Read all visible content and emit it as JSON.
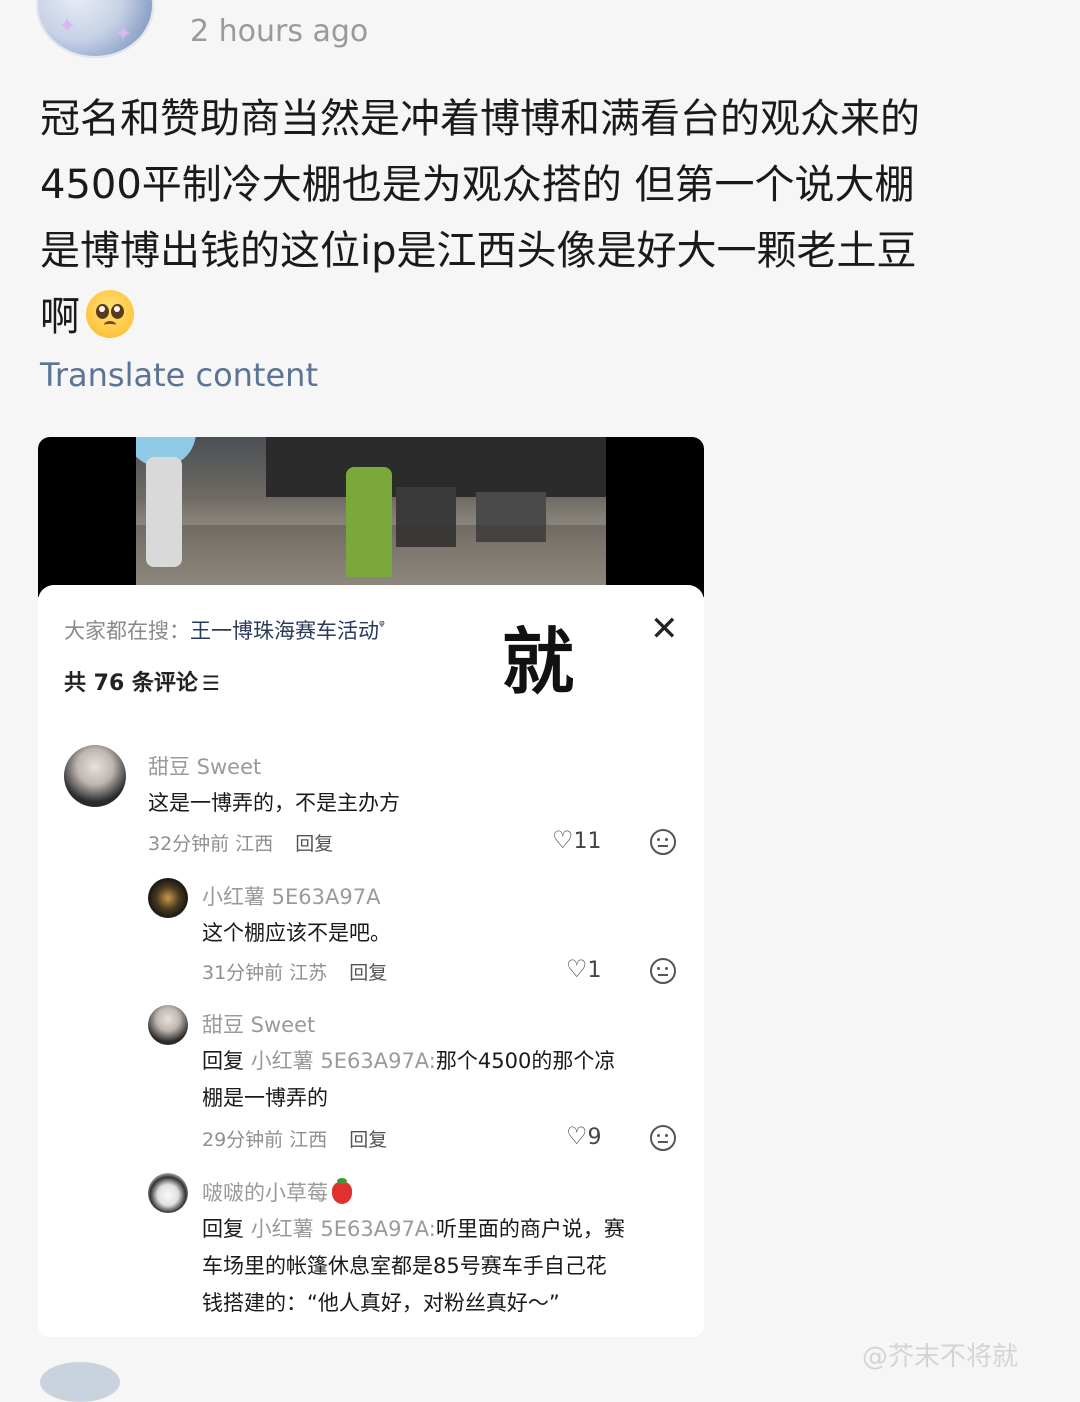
{
  "post": {
    "timestamp": "2 hours ago",
    "text_lines": [
      "冠名和赞助商当然是冲着博博和满看台的观众来的",
      "4500平制冷大棚也是为观众搭的 但第一个说大棚",
      "是博博出钱的这位ip是江西头像是好大一颗老土豆",
      "啊"
    ],
    "emoji": "pleading-face-emoji",
    "translate_label": "Translate content"
  },
  "embedded": {
    "search_prefix": "大家都在搜：",
    "search_keyword": "王一博珠海赛车活动",
    "search_icon": "ᵠ",
    "overlay_char": "就",
    "close_icon": "✕",
    "comment_count": "共 76 条评论",
    "sort_icon": "☰",
    "comments": [
      {
        "name": "甜豆 Sweet",
        "lines": [
          "这是一博弄的，不是主办方"
        ],
        "time": "32分钟前",
        "location": "江西",
        "reply_label": "回复",
        "likes": "11"
      },
      {
        "name": "小红薯 5E63A97A",
        "lines": [
          "这个棚应该不是吧。"
        ],
        "time": "31分钟前",
        "location": "江苏",
        "reply_label": "回复",
        "likes": "1"
      },
      {
        "name": "甜豆 Sweet",
        "reply_prefix": "回复",
        "reply_to": "小红薯 5E63A97A:",
        "lines": [
          "那个4500的那个凉",
          "棚是一博弄的"
        ],
        "time": "29分钟前",
        "location": "江西",
        "reply_label": "回复",
        "likes": "9"
      },
      {
        "name": "啵啵的小草莓",
        "reply_prefix": "回复",
        "reply_to": "小红薯 5E63A97A:",
        "lines": [
          "听里面的商户说，赛",
          "车场里的帐篷休息室都是85号赛车手自己花",
          "钱搭建的：“他人真好，对粉丝真好～”"
        ]
      }
    ]
  },
  "watermark": "@芥末不将就",
  "colors": {
    "background": "#f6f6f6",
    "translate_link": "#5b7394",
    "muted_text": "#9a9a9a"
  }
}
